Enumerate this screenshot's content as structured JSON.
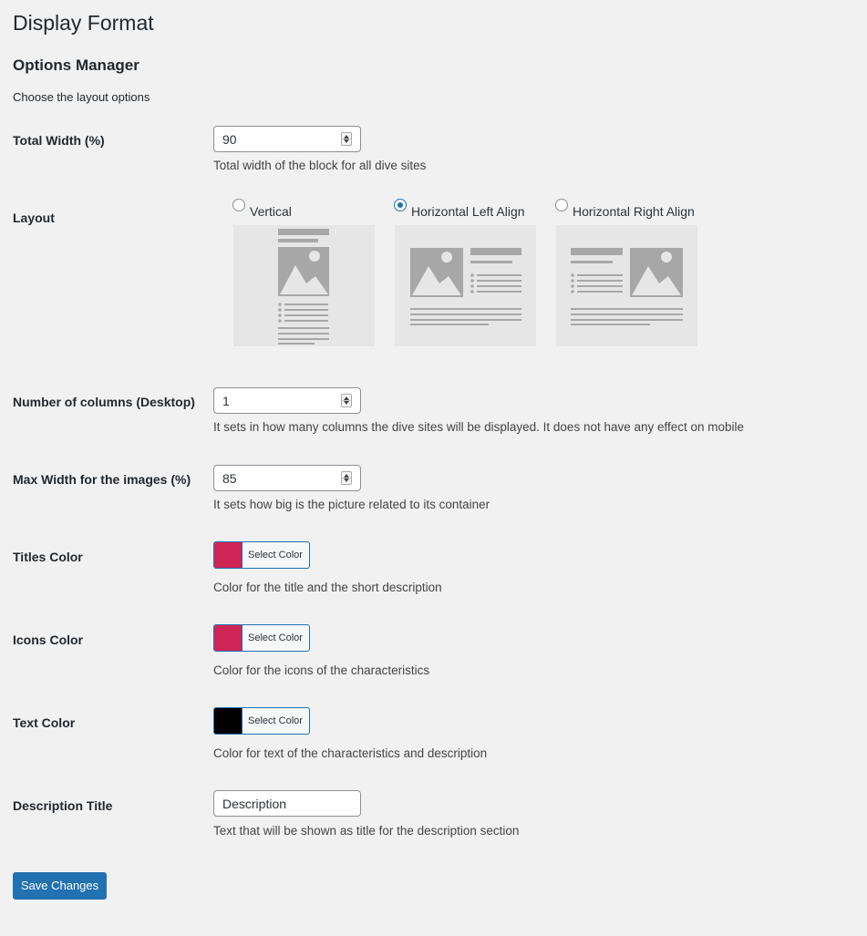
{
  "page": {
    "title": "Display Format"
  },
  "section": {
    "title": "Options Manager",
    "description": "Choose the layout options"
  },
  "fields": {
    "total_width": {
      "label": "Total Width (%)",
      "value": "90",
      "help": "Total width of the block for all dive sites"
    },
    "layout": {
      "label": "Layout",
      "options": [
        {
          "label": "Vertical",
          "checked": false
        },
        {
          "label": "Horizontal Left Align",
          "checked": true
        },
        {
          "label": "Horizontal Right Align",
          "checked": false
        }
      ]
    },
    "columns": {
      "label": "Number of columns (Desktop)",
      "value": "1",
      "help": "It sets in how many columns the dive sites will be displayed. It does not have any effect on mobile"
    },
    "max_width": {
      "label": "Max Width for the images (%)",
      "value": "85",
      "help": "It sets how big is the picture related to its container"
    },
    "titles_color": {
      "label": "Titles Color",
      "button": "Select Color",
      "color": "#cf2456",
      "help": "Color for the title and the short description"
    },
    "icons_color": {
      "label": "Icons Color",
      "button": "Select Color",
      "color": "#cf2456",
      "help": "Color for the icons of the characteristics"
    },
    "text_color": {
      "label": "Text Color",
      "button": "Select Color",
      "color": "#000000",
      "help": "Color for text of the characteristics and description"
    },
    "description_title": {
      "label": "Description Title",
      "value": "Description",
      "help": "Text that will be shown as title for the description section"
    }
  },
  "save_button": "Save Changes"
}
